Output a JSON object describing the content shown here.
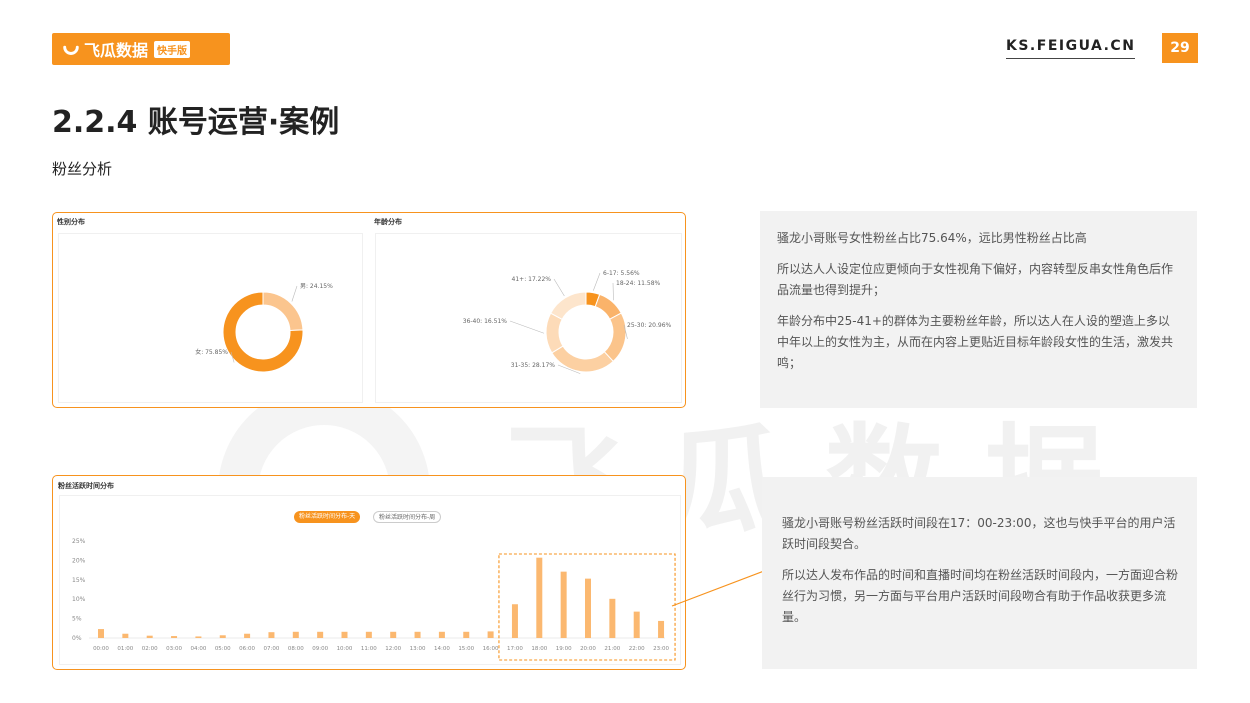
{
  "header": {
    "logo_text": "飞瓜数据",
    "logo_badge": "快手版",
    "site": "KS.FEIGUA.CN",
    "page_number": "29"
  },
  "page": {
    "title": "2.2.4 账号运营·案例",
    "subtitle": "粉丝分析"
  },
  "watermark": {
    "text": "飞瓜数据"
  },
  "colors": {
    "accent": "#f7931e",
    "female": "#f7931e",
    "male": "#fbc58e",
    "bar": "#fbb870",
    "box_bg": "#f2f2f2"
  },
  "gender_panel": {
    "title": "性别分布"
  },
  "age_panel": {
    "title": "年龄分布"
  },
  "activity_panel": {
    "title": "粉丝活跃时间分布",
    "tab_day": "粉丝活跃时间分布-天",
    "tab_week": "粉丝活跃时间分布-周"
  },
  "chart_data": [
    {
      "type": "pie",
      "title": "性别分布",
      "labels": [
        "男",
        "女"
      ],
      "values": [
        24.15,
        75.85
      ],
      "label_texts": [
        "男: 24.15%",
        "女: 75.85%"
      ],
      "colors": [
        "#fbc58e",
        "#f7931e"
      ]
    },
    {
      "type": "pie",
      "title": "年龄分布",
      "labels": [
        "6-17",
        "18-24",
        "25-30",
        "31-35",
        "36-40",
        "41+"
      ],
      "values": [
        5.56,
        11.58,
        20.96,
        28.17,
        16.51,
        17.22
      ],
      "label_texts": [
        "6-17: 5.56%",
        "18-24: 11.58%",
        "25-30: 20.96%",
        "31-35: 28.17%",
        "36-40: 16.51%",
        "41+: 17.22%"
      ],
      "colors": [
        "#f7931e",
        "#fab36a",
        "#fbc48b",
        "#fcd0a2",
        "#fddbb8",
        "#fde5cc"
      ]
    },
    {
      "type": "bar",
      "title": "粉丝活跃时间分布",
      "categories": [
        "00:00",
        "01:00",
        "02:00",
        "03:00",
        "04:00",
        "05:00",
        "06:00",
        "07:00",
        "08:00",
        "09:00",
        "10:00",
        "11:00",
        "12:00",
        "13:00",
        "14:00",
        "15:00",
        "16:00",
        "17:00",
        "18:00",
        "19:00",
        "20:00",
        "21:00",
        "22:00",
        "23:00"
      ],
      "values": [
        2.3,
        1.1,
        0.6,
        0.5,
        0.4,
        0.7,
        1.1,
        1.5,
        1.6,
        1.6,
        1.6,
        1.6,
        1.6,
        1.6,
        1.6,
        1.6,
        1.7,
        8.7,
        20.7,
        17.1,
        15.3,
        10.1,
        6.8,
        4.4
      ],
      "ylim": [
        0,
        25
      ],
      "yticks": [
        "0%",
        "5%",
        "10%",
        "15%",
        "20%",
        "25%"
      ],
      "ytick_values": [
        0,
        5,
        10,
        15,
        20,
        25
      ],
      "highlight_range": [
        "17:00",
        "23:00"
      ],
      "grid": false
    }
  ],
  "notes": {
    "box1": [
      "骚龙小哥账号女性粉丝占比75.64%，远比男性粉丝占比高",
      "所以达人人设定位应更倾向于女性视角下偏好，内容转型反串女性角色后作品流量也得到提升；",
      "年龄分布中25-41+的群体为主要粉丝年龄，所以达人在人设的塑造上多以中年以上的女性为主，从而在内容上更贴近目标年龄段女性的生活，激发共鸣；"
    ],
    "box2": [
      "骚龙小哥账号粉丝活跃时间段在17：00-23:00，这也与快手平台的用户活跃时间段契合。",
      "所以达人发布作品的时间和直播时间均在粉丝活跃时间段内，一方面迎合粉丝行为习惯，另一方面与平台用户活跃时间段吻合有助于作品收获更多流量。"
    ]
  }
}
